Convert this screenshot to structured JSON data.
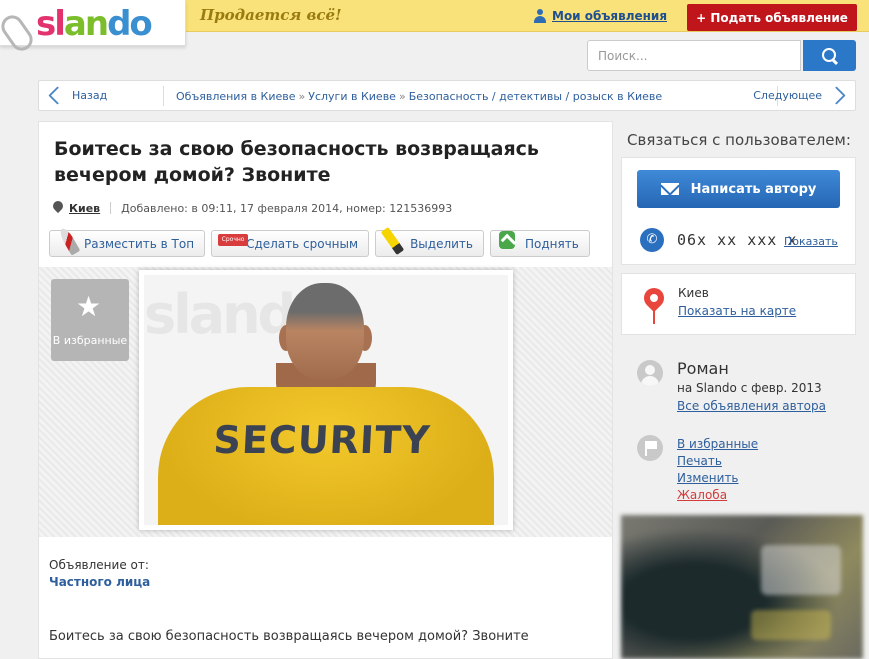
{
  "header": {
    "logo": [
      "sl",
      "an",
      "do"
    ],
    "tagline": "Продается всё!",
    "my_ads": "Мои объявления",
    "post_ad": "+ Подать объявление"
  },
  "search": {
    "placeholder": "Поиск..."
  },
  "breadcrumb": {
    "back": "Назад",
    "items": [
      "Объявления в Киеве",
      "Услуги в Киеве",
      "Безопасность / детективы / розыск в Киеве"
    ],
    "separator": "»",
    "next": "Следующее"
  },
  "listing": {
    "title": "Боитесь за свою безопасность возвращаясь вечером домой? Звоните",
    "city": "Киев",
    "added": "Добавлено: в 09:11, 17 февраля 2014, номер: 121536993",
    "actions": [
      {
        "label": "Разместить в Топ",
        "icon": "rocket-icon"
      },
      {
        "label": "Сделать срочным",
        "icon": "urgent-sticker-icon",
        "sticker": "Срочно"
      },
      {
        "label": "Выделить",
        "icon": "highlighter-icon"
      },
      {
        "label": "Поднять",
        "icon": "lift-up-icon"
      }
    ],
    "favorite_label": "В избранные",
    "photo_text": "SECURITY",
    "photo_watermark": "slando",
    "from_label": "Объявление от:",
    "from_value": "Частного лица",
    "description": "Боитесь за свою безопасность возвращаясь вечером домой? Звоните"
  },
  "sidebar": {
    "contact_heading": "Связаться с пользователем:",
    "write_button": "Написать автору",
    "phone": "06x xx xxx x",
    "phone_show": "Показать",
    "city": "Киев",
    "map_link": "Показать на карте",
    "user_name": "Роман",
    "since": "на Slando с февр. 2013",
    "all_ads": "Все объявления автора",
    "links": [
      "В избранные",
      "Печать",
      "Изменить",
      "Жалоба"
    ]
  }
}
